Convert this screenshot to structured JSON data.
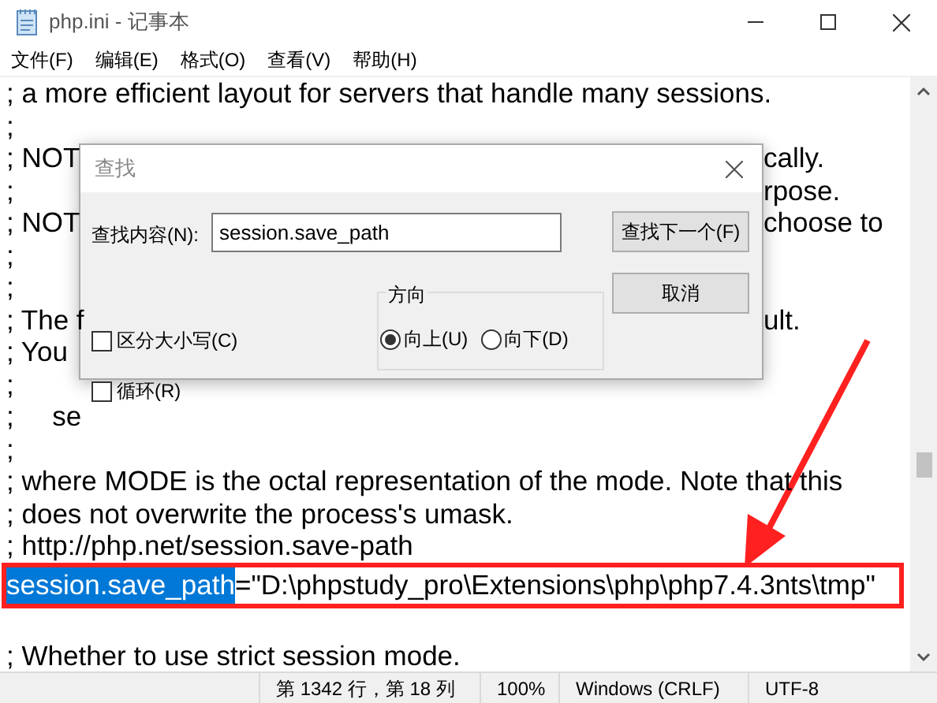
{
  "window": {
    "title": "php.ini - 记事本"
  },
  "menu": [
    "文件(F)",
    "编辑(E)",
    "格式(O)",
    "查看(V)",
    "帮助(H)"
  ],
  "lines": [
    {
      "kind": "text",
      "text": "; a more efficient layout for servers that handle many sessions."
    },
    {
      "kind": "text",
      "text": ";"
    },
    {
      "kind": "split",
      "left": "; NOT",
      "right": "cally."
    },
    {
      "kind": "split",
      "left": ";",
      "right": "rpose."
    },
    {
      "kind": "split",
      "left": "; NOT",
      "right": "choose to"
    },
    {
      "kind": "text",
      "text": ";"
    },
    {
      "kind": "text",
      "text": ";"
    },
    {
      "kind": "split",
      "left": "; The f",
      "right": "ult."
    },
    {
      "kind": "text",
      "text": "; You"
    },
    {
      "kind": "text",
      "text": ";"
    },
    {
      "kind": "text",
      "text": ";     se"
    },
    {
      "kind": "text",
      "text": ";"
    },
    {
      "kind": "text",
      "text": "; where MODE is the octal representation of the mode. Note that this"
    },
    {
      "kind": "text",
      "text": "; does not overwrite the process's umask."
    },
    {
      "kind": "text",
      "text": "; http://php.net/session.save-path"
    },
    {
      "kind": "highlight",
      "selected_text": "session.save_path",
      "text": "=\"D:\\phpstudy_pro\\Extensions\\php\\php7.4.3nts\\tmp\""
    },
    {
      "kind": "blank"
    },
    {
      "kind": "text",
      "text": "; Whether to use strict session mode."
    }
  ],
  "find_dialog": {
    "title": "查找",
    "search_label": "查找内容(N):",
    "search_value": "session.save_path",
    "find_next": "查找下一个(F)",
    "cancel": "取消",
    "direction": {
      "label": "方向",
      "options": [
        {
          "label": "向上(U)",
          "selected": true
        },
        {
          "label": "向下(D)",
          "selected": false
        }
      ]
    },
    "checkboxes": [
      {
        "label": "区分大小写(C)",
        "checked": false
      },
      {
        "label": "循环(R)",
        "checked": false
      }
    ]
  },
  "status_bar": [
    "第 1342 行，第 18 列",
    "100%",
    "Windows (CRLF)",
    "UTF-8"
  ]
}
